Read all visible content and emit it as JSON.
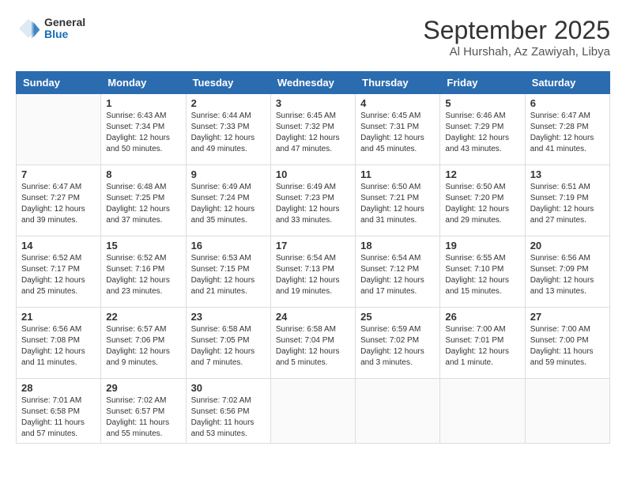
{
  "header": {
    "logo": {
      "general": "General",
      "blue": "Blue"
    },
    "title": "September 2025",
    "subtitle": "Al Hurshah, Az Zawiyah, Libya"
  },
  "days_of_week": [
    "Sunday",
    "Monday",
    "Tuesday",
    "Wednesday",
    "Thursday",
    "Friday",
    "Saturday"
  ],
  "weeks": [
    [
      {
        "date": "",
        "sunrise": "",
        "sunset": "",
        "daylight": ""
      },
      {
        "date": "1",
        "sunrise": "Sunrise: 6:43 AM",
        "sunset": "Sunset: 7:34 PM",
        "daylight": "Daylight: 12 hours and 50 minutes."
      },
      {
        "date": "2",
        "sunrise": "Sunrise: 6:44 AM",
        "sunset": "Sunset: 7:33 PM",
        "daylight": "Daylight: 12 hours and 49 minutes."
      },
      {
        "date": "3",
        "sunrise": "Sunrise: 6:45 AM",
        "sunset": "Sunset: 7:32 PM",
        "daylight": "Daylight: 12 hours and 47 minutes."
      },
      {
        "date": "4",
        "sunrise": "Sunrise: 6:45 AM",
        "sunset": "Sunset: 7:31 PM",
        "daylight": "Daylight: 12 hours and 45 minutes."
      },
      {
        "date": "5",
        "sunrise": "Sunrise: 6:46 AM",
        "sunset": "Sunset: 7:29 PM",
        "daylight": "Daylight: 12 hours and 43 minutes."
      },
      {
        "date": "6",
        "sunrise": "Sunrise: 6:47 AM",
        "sunset": "Sunset: 7:28 PM",
        "daylight": "Daylight: 12 hours and 41 minutes."
      }
    ],
    [
      {
        "date": "7",
        "sunrise": "Sunrise: 6:47 AM",
        "sunset": "Sunset: 7:27 PM",
        "daylight": "Daylight: 12 hours and 39 minutes."
      },
      {
        "date": "8",
        "sunrise": "Sunrise: 6:48 AM",
        "sunset": "Sunset: 7:25 PM",
        "daylight": "Daylight: 12 hours and 37 minutes."
      },
      {
        "date": "9",
        "sunrise": "Sunrise: 6:49 AM",
        "sunset": "Sunset: 7:24 PM",
        "daylight": "Daylight: 12 hours and 35 minutes."
      },
      {
        "date": "10",
        "sunrise": "Sunrise: 6:49 AM",
        "sunset": "Sunset: 7:23 PM",
        "daylight": "Daylight: 12 hours and 33 minutes."
      },
      {
        "date": "11",
        "sunrise": "Sunrise: 6:50 AM",
        "sunset": "Sunset: 7:21 PM",
        "daylight": "Daylight: 12 hours and 31 minutes."
      },
      {
        "date": "12",
        "sunrise": "Sunrise: 6:50 AM",
        "sunset": "Sunset: 7:20 PM",
        "daylight": "Daylight: 12 hours and 29 minutes."
      },
      {
        "date": "13",
        "sunrise": "Sunrise: 6:51 AM",
        "sunset": "Sunset: 7:19 PM",
        "daylight": "Daylight: 12 hours and 27 minutes."
      }
    ],
    [
      {
        "date": "14",
        "sunrise": "Sunrise: 6:52 AM",
        "sunset": "Sunset: 7:17 PM",
        "daylight": "Daylight: 12 hours and 25 minutes."
      },
      {
        "date": "15",
        "sunrise": "Sunrise: 6:52 AM",
        "sunset": "Sunset: 7:16 PM",
        "daylight": "Daylight: 12 hours and 23 minutes."
      },
      {
        "date": "16",
        "sunrise": "Sunrise: 6:53 AM",
        "sunset": "Sunset: 7:15 PM",
        "daylight": "Daylight: 12 hours and 21 minutes."
      },
      {
        "date": "17",
        "sunrise": "Sunrise: 6:54 AM",
        "sunset": "Sunset: 7:13 PM",
        "daylight": "Daylight: 12 hours and 19 minutes."
      },
      {
        "date": "18",
        "sunrise": "Sunrise: 6:54 AM",
        "sunset": "Sunset: 7:12 PM",
        "daylight": "Daylight: 12 hours and 17 minutes."
      },
      {
        "date": "19",
        "sunrise": "Sunrise: 6:55 AM",
        "sunset": "Sunset: 7:10 PM",
        "daylight": "Daylight: 12 hours and 15 minutes."
      },
      {
        "date": "20",
        "sunrise": "Sunrise: 6:56 AM",
        "sunset": "Sunset: 7:09 PM",
        "daylight": "Daylight: 12 hours and 13 minutes."
      }
    ],
    [
      {
        "date": "21",
        "sunrise": "Sunrise: 6:56 AM",
        "sunset": "Sunset: 7:08 PM",
        "daylight": "Daylight: 12 hours and 11 minutes."
      },
      {
        "date": "22",
        "sunrise": "Sunrise: 6:57 AM",
        "sunset": "Sunset: 7:06 PM",
        "daylight": "Daylight: 12 hours and 9 minutes."
      },
      {
        "date": "23",
        "sunrise": "Sunrise: 6:58 AM",
        "sunset": "Sunset: 7:05 PM",
        "daylight": "Daylight: 12 hours and 7 minutes."
      },
      {
        "date": "24",
        "sunrise": "Sunrise: 6:58 AM",
        "sunset": "Sunset: 7:04 PM",
        "daylight": "Daylight: 12 hours and 5 minutes."
      },
      {
        "date": "25",
        "sunrise": "Sunrise: 6:59 AM",
        "sunset": "Sunset: 7:02 PM",
        "daylight": "Daylight: 12 hours and 3 minutes."
      },
      {
        "date": "26",
        "sunrise": "Sunrise: 7:00 AM",
        "sunset": "Sunset: 7:01 PM",
        "daylight": "Daylight: 12 hours and 1 minute."
      },
      {
        "date": "27",
        "sunrise": "Sunrise: 7:00 AM",
        "sunset": "Sunset: 7:00 PM",
        "daylight": "Daylight: 11 hours and 59 minutes."
      }
    ],
    [
      {
        "date": "28",
        "sunrise": "Sunrise: 7:01 AM",
        "sunset": "Sunset: 6:58 PM",
        "daylight": "Daylight: 11 hours and 57 minutes."
      },
      {
        "date": "29",
        "sunrise": "Sunrise: 7:02 AM",
        "sunset": "Sunset: 6:57 PM",
        "daylight": "Daylight: 11 hours and 55 minutes."
      },
      {
        "date": "30",
        "sunrise": "Sunrise: 7:02 AM",
        "sunset": "Sunset: 6:56 PM",
        "daylight": "Daylight: 11 hours and 53 minutes."
      },
      {
        "date": "",
        "sunrise": "",
        "sunset": "",
        "daylight": ""
      },
      {
        "date": "",
        "sunrise": "",
        "sunset": "",
        "daylight": ""
      },
      {
        "date": "",
        "sunrise": "",
        "sunset": "",
        "daylight": ""
      },
      {
        "date": "",
        "sunrise": "",
        "sunset": "",
        "daylight": ""
      }
    ]
  ]
}
